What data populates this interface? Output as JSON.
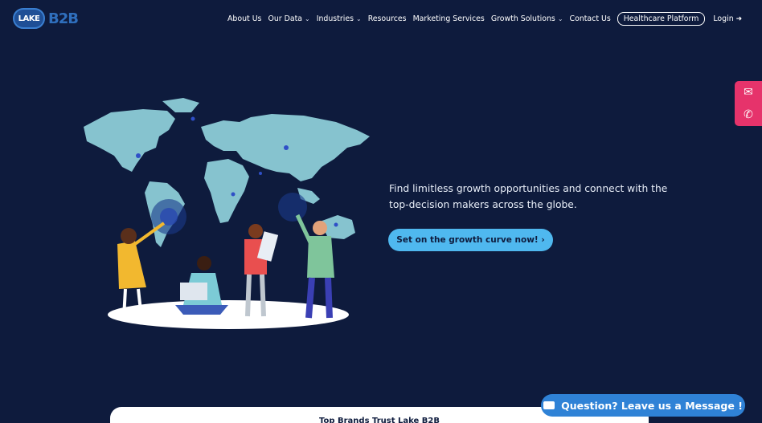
{
  "logo": {
    "lake": "LAKE",
    "b2b": "B2B"
  },
  "nav": {
    "items": [
      {
        "label": "About Us",
        "dropdown": false
      },
      {
        "label": "Our Data",
        "dropdown": true
      },
      {
        "label": "Industries",
        "dropdown": true
      },
      {
        "label": "Resources",
        "dropdown": false
      },
      {
        "label": "Marketing Services",
        "dropdown": false
      },
      {
        "label": "Growth Solutions",
        "dropdown": true
      },
      {
        "label": "Contact Us",
        "dropdown": false
      }
    ],
    "healthcare": "Healthcare Platform",
    "login": "Login"
  },
  "hero": {
    "text": "Find limitless growth opportunities and connect with the top-decision makers across the globe.",
    "cta": "Set on the growth curve now!  ›"
  },
  "card": {
    "title": "Top Brands Trust Lake B2B"
  },
  "message": {
    "label": "Question? Leave us a Message !"
  },
  "colors": {
    "background": "#0e1b3d",
    "accent": "#4fb8ef",
    "side": "#e6336b",
    "chat": "#2f82d6"
  }
}
